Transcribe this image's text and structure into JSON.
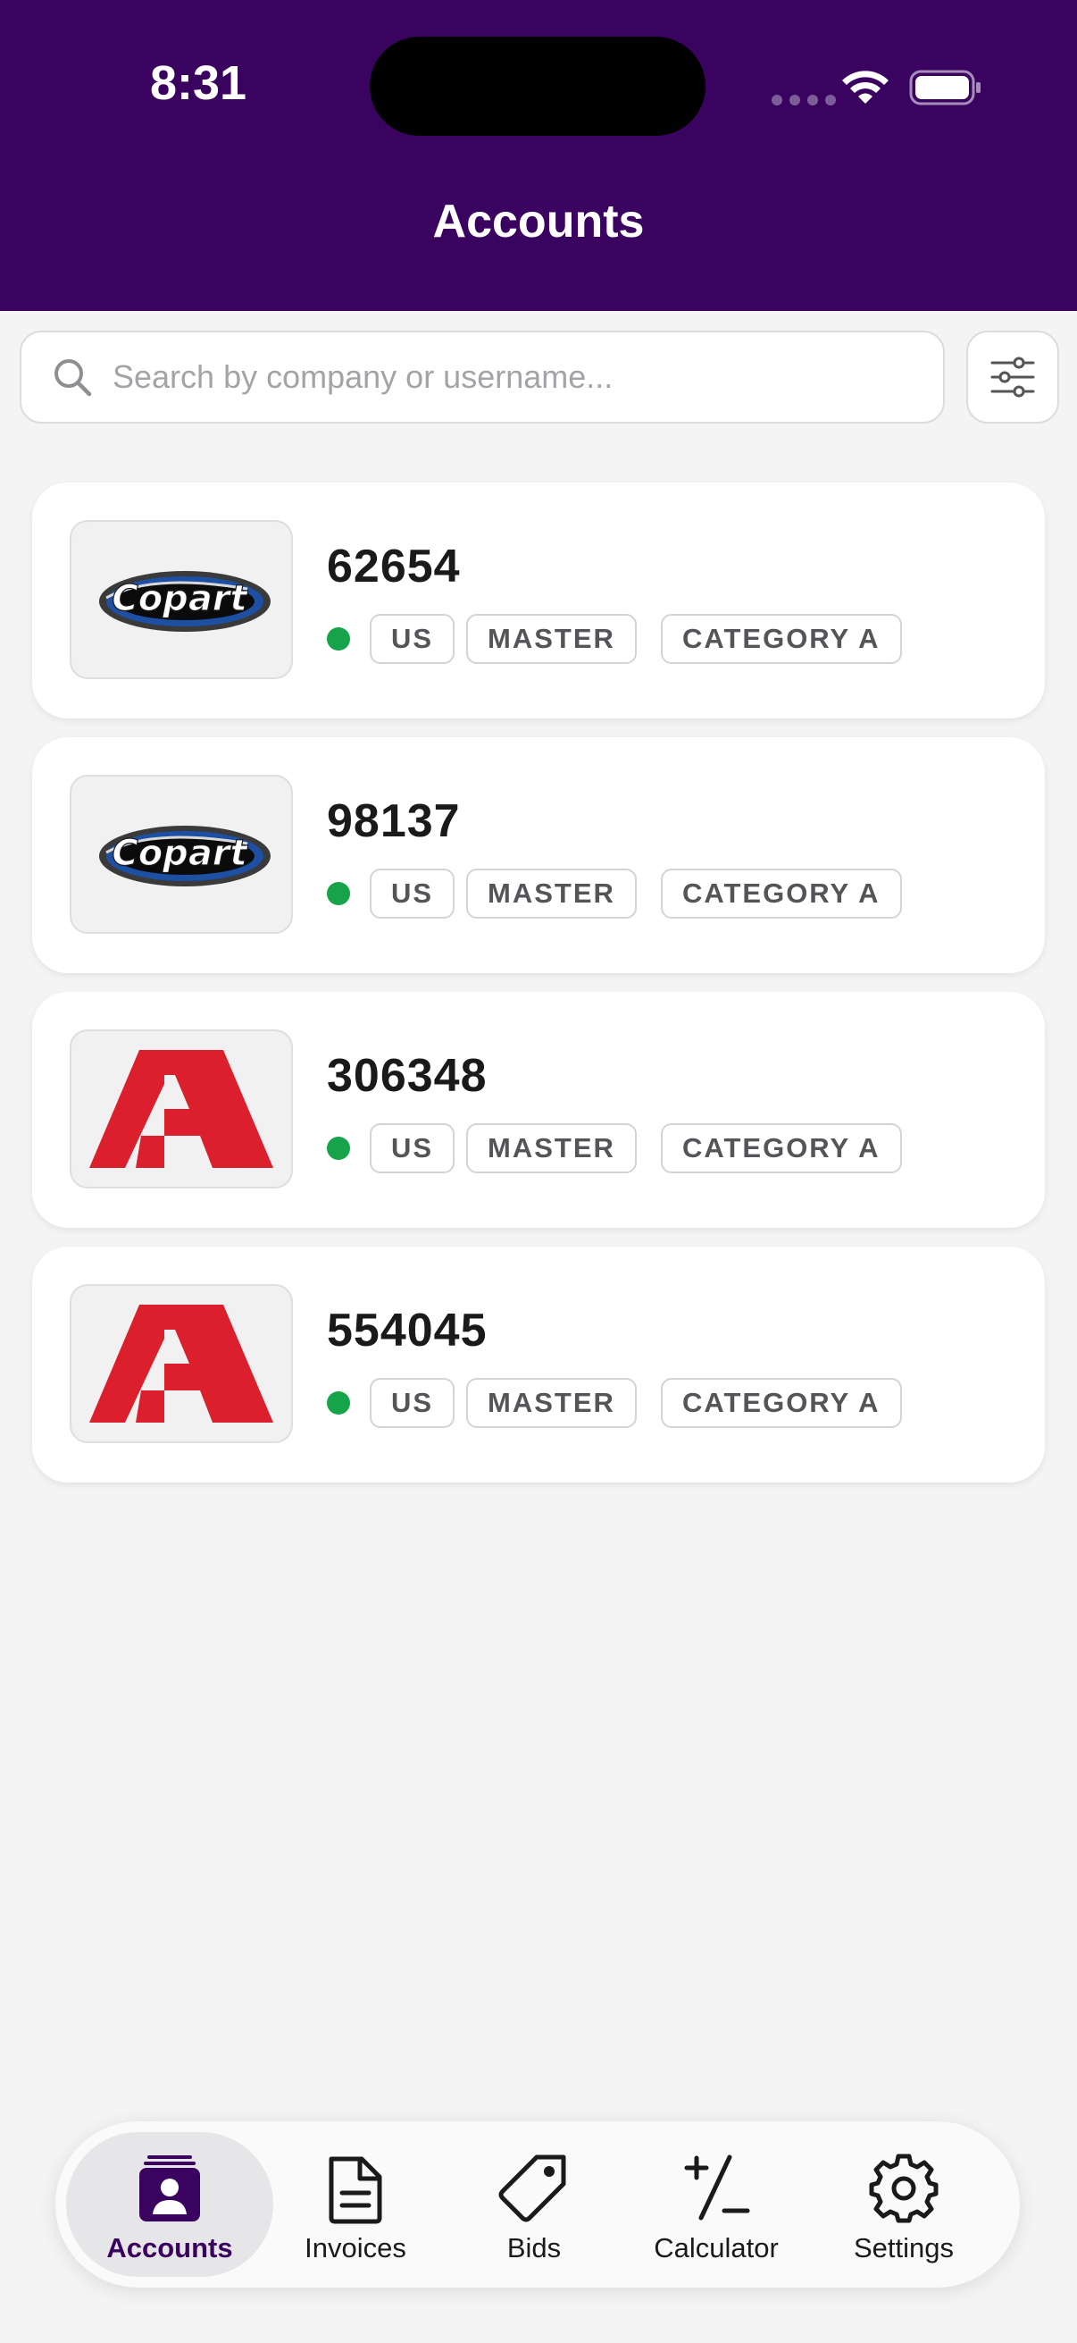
{
  "status_bar": {
    "time": "8:31"
  },
  "header": {
    "title": "Accounts"
  },
  "search": {
    "placeholder": "Search by company or username..."
  },
  "accounts": [
    {
      "id": "62654",
      "logo": "copart-logo",
      "logo_text": "Copart",
      "status": "active",
      "region": "US",
      "role": "MASTER",
      "category": "CATEGORY A"
    },
    {
      "id": "98137",
      "logo": "copart-logo",
      "logo_text": "Copart",
      "status": "active",
      "region": "US",
      "role": "MASTER",
      "category": "CATEGORY A"
    },
    {
      "id": "306348",
      "logo": "iaa-logo",
      "logo_text": "IAA",
      "status": "active",
      "region": "US",
      "role": "MASTER",
      "category": "CATEGORY A"
    },
    {
      "id": "554045",
      "logo": "iaa-logo",
      "logo_text": "IAA",
      "status": "active",
      "region": "US",
      "role": "MASTER",
      "category": "CATEGORY A"
    }
  ],
  "tabs": [
    {
      "label": "Accounts",
      "icon": "accounts-icon",
      "active": true
    },
    {
      "label": "Invoices",
      "icon": "invoice-icon",
      "active": false
    },
    {
      "label": "Bids",
      "icon": "tag-icon",
      "active": false
    },
    {
      "label": "Calculator",
      "icon": "calculator-icon",
      "active": false
    },
    {
      "label": "Settings",
      "icon": "gear-icon",
      "active": false
    }
  ],
  "colors": {
    "header_bg": "#3b0360",
    "accent": "#3b0360",
    "status_active": "#16a34a",
    "iaa_red": "#dc1f2d",
    "copart_blue": "#1d4fa3"
  }
}
